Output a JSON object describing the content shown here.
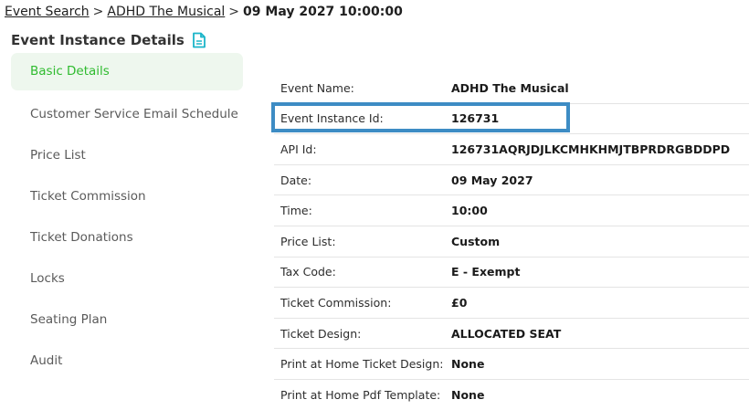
{
  "breadcrumb": {
    "items": [
      "Event Search",
      "ADHD The Musical"
    ],
    "separator": ">",
    "current": "09 May 2027 10:00:00"
  },
  "page": {
    "title": "Event Instance Details",
    "title_icon": "document-icon"
  },
  "sidebar": {
    "items": [
      {
        "label": "Basic Details",
        "active": true
      },
      {
        "label": "Customer Service Email Schedule",
        "active": false
      },
      {
        "label": "Price List",
        "active": false
      },
      {
        "label": "Ticket Commission",
        "active": false
      },
      {
        "label": "Ticket Donations",
        "active": false
      },
      {
        "label": "Locks",
        "active": false
      },
      {
        "label": "Seating Plan",
        "active": false
      },
      {
        "label": "Audit",
        "active": false
      }
    ]
  },
  "details": {
    "rows": [
      {
        "label": "Event Name:",
        "value": "ADHD The Musical"
      },
      {
        "label": "Event Instance Id:",
        "value": "126731"
      },
      {
        "label": "API Id:",
        "value": "126731AQRJDJLKCMHKHMJTBPRDRGBDDPD"
      },
      {
        "label": "Date:",
        "value": "09 May 2027"
      },
      {
        "label": "Time:",
        "value": "10:00"
      },
      {
        "label": "Price List:",
        "value": "Custom"
      },
      {
        "label": "Tax Code:",
        "value": "E - Exempt"
      },
      {
        "label": "Ticket Commission:",
        "value": "£0"
      },
      {
        "label": "Ticket Design:",
        "value": "ALLOCATED SEAT"
      },
      {
        "label": "Print at Home Ticket Design:",
        "value": "None"
      },
      {
        "label": "Print at Home Pdf Template:",
        "value": "None"
      }
    ]
  },
  "colors": {
    "accent_green": "#2fbb2f",
    "active_bg": "#eef7ee",
    "highlight_blue": "#3d8cc4",
    "icon_teal": "#1bb5c9"
  }
}
